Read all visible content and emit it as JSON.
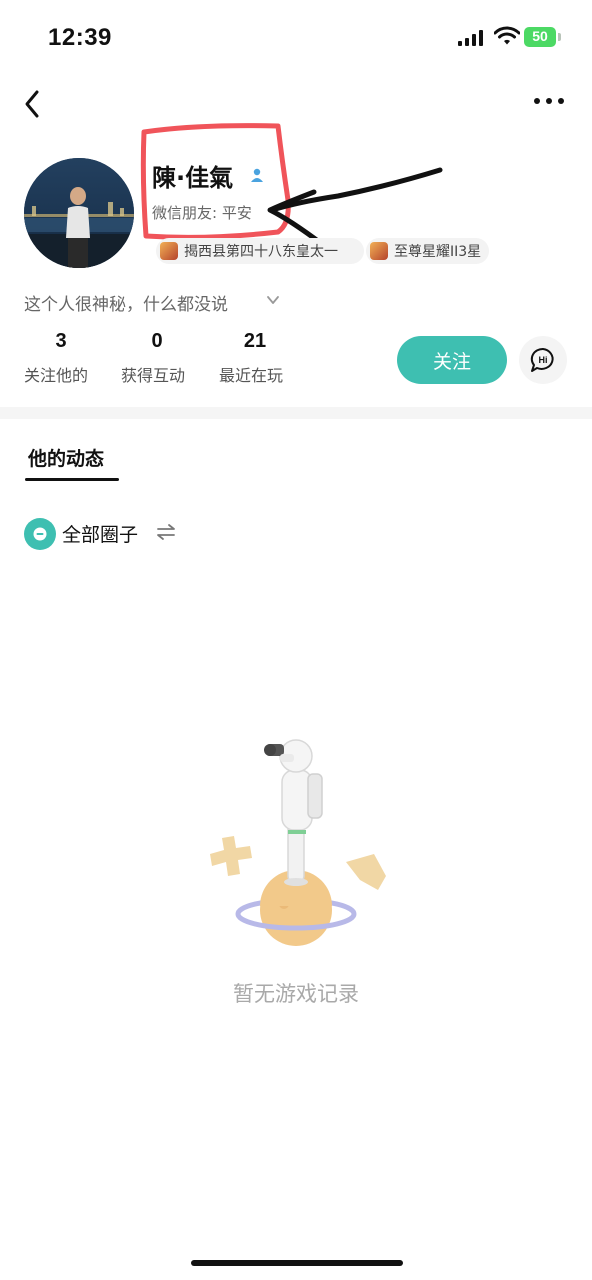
{
  "status_bar": {
    "time": "12:39",
    "battery": "50"
  },
  "profile": {
    "name": "陳·佳氣",
    "wechat_friend": "微信朋友: 平安",
    "tags": [
      "揭西县第四十八东皇太一",
      "至尊星耀II3星"
    ],
    "bio": "这个人很神秘，什么都没说"
  },
  "stats": [
    {
      "value": "3",
      "label": "关注他的"
    },
    {
      "value": "0",
      "label": "获得互动"
    },
    {
      "value": "21",
      "label": "最近在玩"
    }
  ],
  "actions": {
    "follow_label": "关注",
    "hi_label": "Hi"
  },
  "tabs": {
    "active": "他的动态"
  },
  "filter": {
    "circle_label": "全部圈子"
  },
  "empty_state": {
    "text": "暂无游戏记录"
  },
  "colors": {
    "accent": "#3ebfb1",
    "annotation_box": "#f0545a",
    "battery": "#4cd964"
  }
}
